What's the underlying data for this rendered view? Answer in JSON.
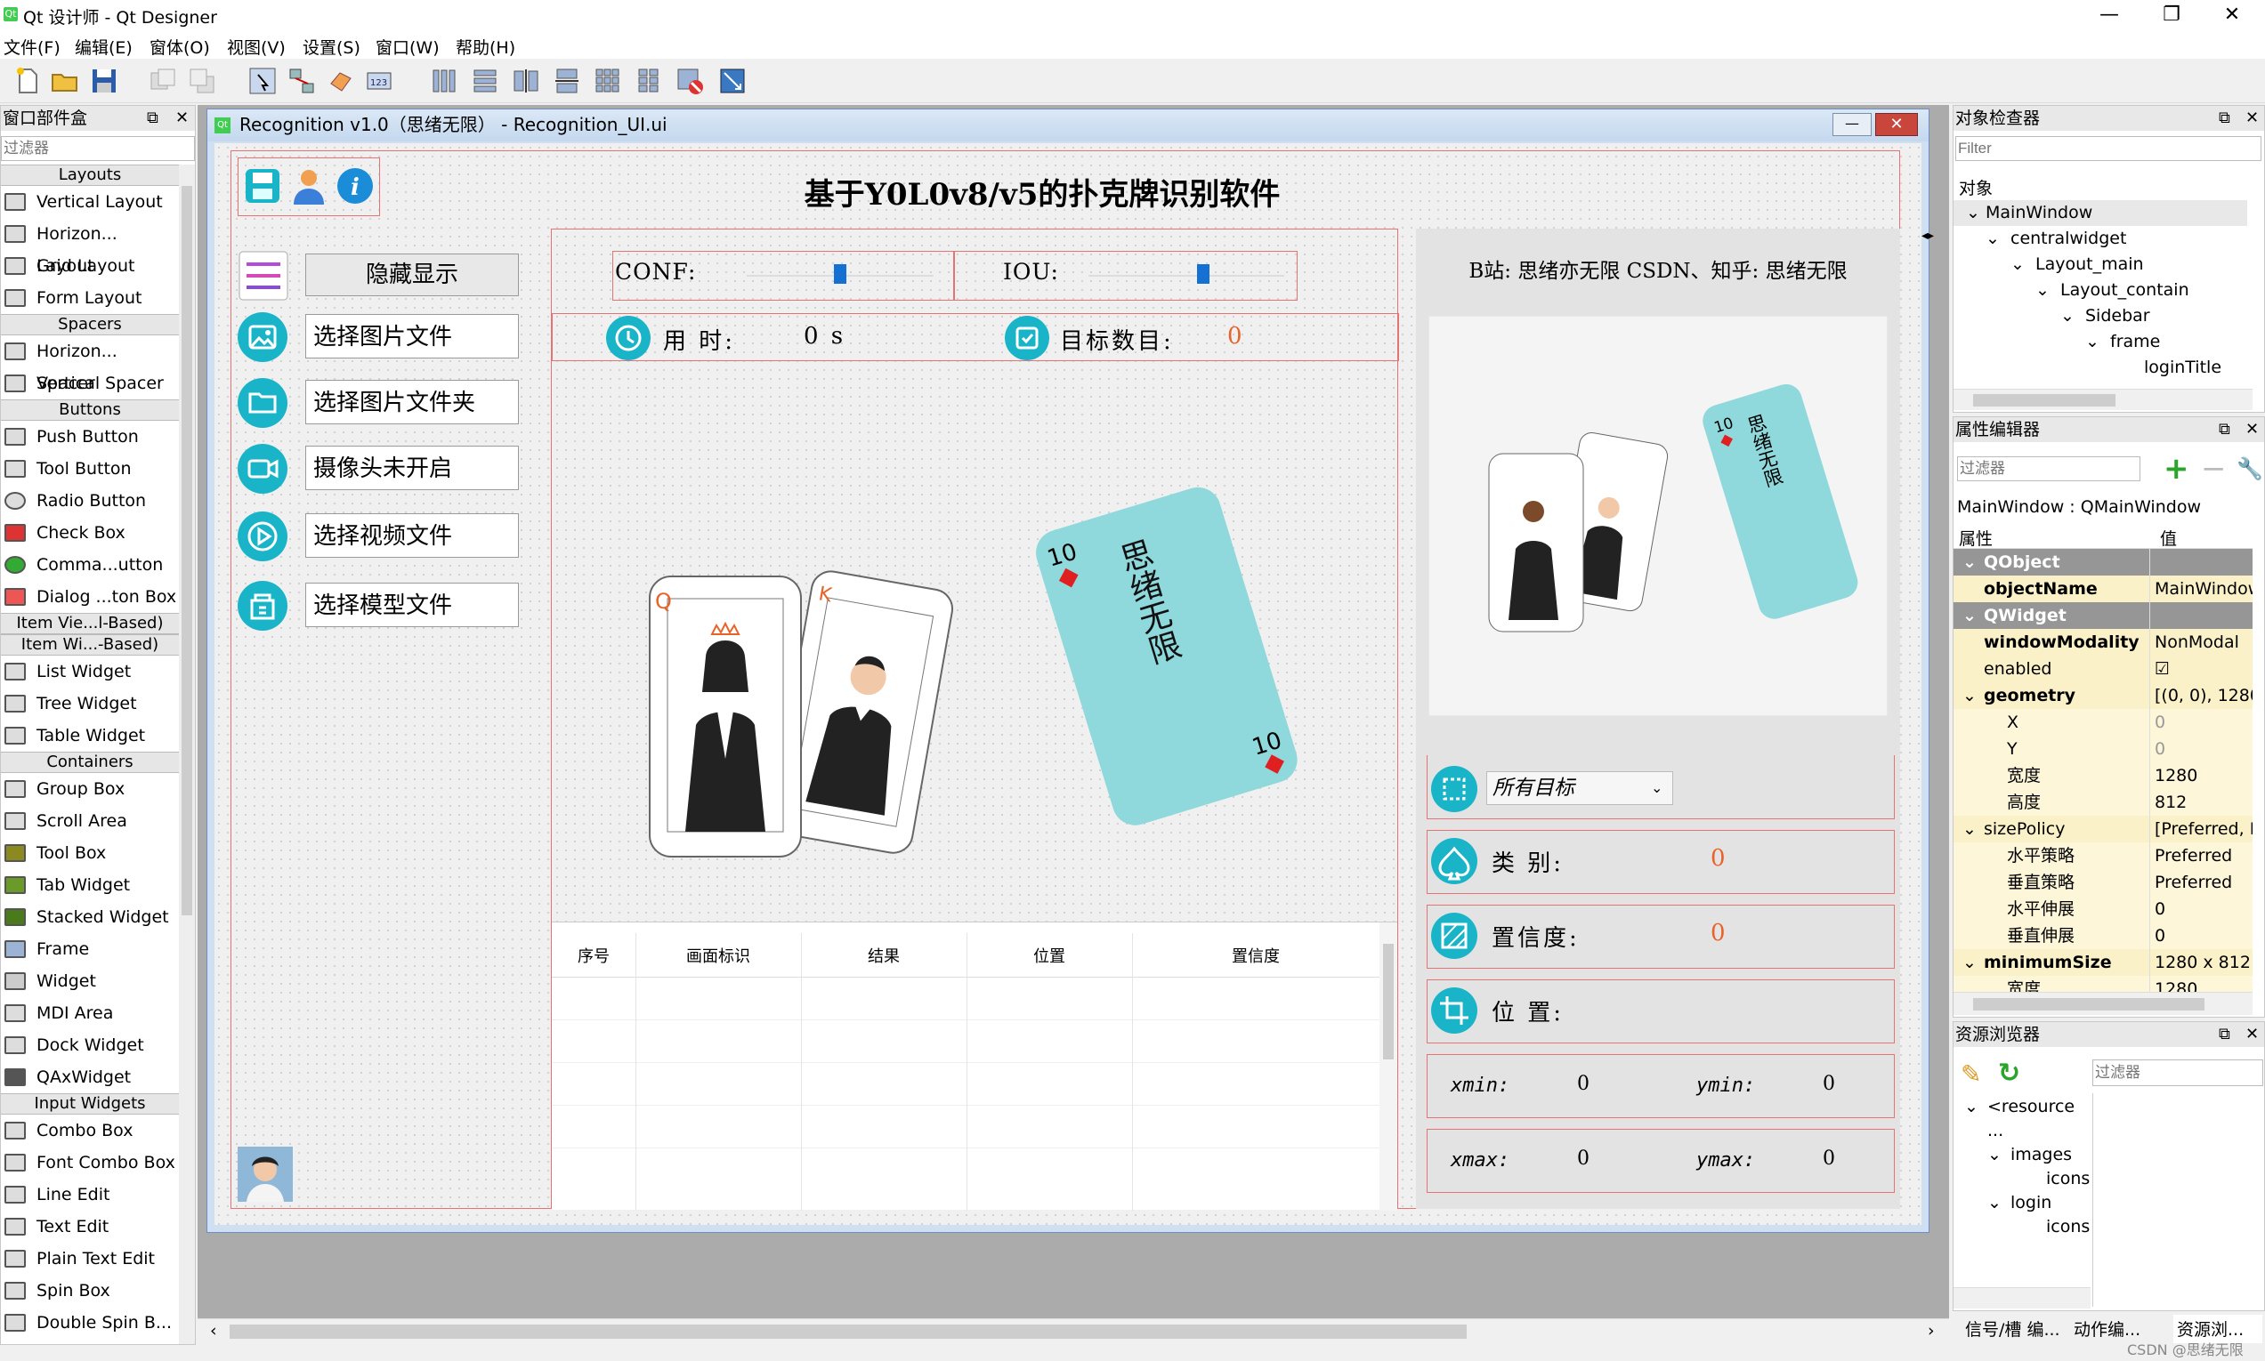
{
  "app": {
    "title": "Qt 设计师 - Qt Designer",
    "logo": "Qt"
  },
  "window_controls": {
    "minimize": "—",
    "restore": "❐",
    "close": "✕"
  },
  "menu": [
    "文件(F)",
    "编辑(E)",
    "窗体(O)",
    "视图(V)",
    "设置(S)",
    "窗口(W)",
    "帮助(H)"
  ],
  "widget_box": {
    "title": "窗口部件盒",
    "filter_placeholder": "过滤器",
    "categories": {
      "layouts": "Layouts",
      "spacers": "Spacers",
      "buttons": "Buttons",
      "item_views": "Item Vie...l-Based)",
      "item_widgets": "Item Wi...-Based)",
      "containers": "Containers",
      "input_widgets": "Input Widgets"
    },
    "layouts": [
      "Vertical Layout",
      "Horizon... Layout",
      "Grid Layout",
      "Form Layout"
    ],
    "spacers": [
      "Horizon... Spacer",
      "Vertical Spacer"
    ],
    "buttons": [
      "Push Button",
      "Tool Button",
      "Radio Button",
      "Check Box",
      "Comma...utton",
      "Dialog ...ton Box"
    ],
    "item_widgets": [
      "List Widget",
      "Tree Widget",
      "Table Widget"
    ],
    "containers": [
      "Group Box",
      "Scroll Area",
      "Tool Box",
      "Tab Widget",
      "Stacked Widget",
      "Frame",
      "Widget",
      "MDI Area",
      "Dock Widget",
      "QAxWidget"
    ],
    "input_widgets": [
      "Combo Box",
      "Font Combo Box",
      "Line Edit",
      "Text Edit",
      "Plain Text Edit",
      "Spin Box",
      "Double Spin B..."
    ]
  },
  "form": {
    "window_title": "Recognition v1.0（思绪无限） - Recognition_UI.ui",
    "heading": "基于Y0L0v8/v5的扑克牌识别软件",
    "toggle_label": "隐藏显示",
    "side_buttons": [
      "选择图片文件",
      "选择图片文件夹",
      "摄像头未开启",
      "选择视频文件",
      "选择模型文件"
    ],
    "conf_label": "CONF:",
    "iou_label": "IOU:",
    "conf_value": 0.5,
    "iou_value": 0.45,
    "time_label": "用 时:",
    "time_value": "0 s",
    "count_label": "目标数目:",
    "count_value": "0",
    "table_headers": [
      "序号",
      "画面标识",
      "结果",
      "位置",
      "置信度"
    ],
    "bili_text": "B站: 思绪亦无限 CSDN、知乎: 思绪无限",
    "card_text": "思绪无限",
    "card_rank": "10",
    "face_card_rank": "Q",
    "king_rank": "K",
    "target_select": "所有目标",
    "class_label": "类 别:",
    "class_value": "0",
    "conf_result_label": "置信度:",
    "conf_result_value": "0",
    "pos_label": "位 置:",
    "xmin_label": "xmin:",
    "xmin_value": "0",
    "ymin_label": "ymin:",
    "ymin_value": "0",
    "xmax_label": "xmax:",
    "xmax_value": "0",
    "ymax_label": "ymax:",
    "ymax_value": "0"
  },
  "object_inspector": {
    "title": "对象检查器",
    "filter_placeholder": "Filter",
    "column": "对象",
    "tree": [
      "MainWindow",
      "centralwidget",
      "Layout_main",
      "Layout_contain",
      "Sidebar",
      "frame",
      "loginTitle"
    ]
  },
  "property_editor": {
    "title": "属性编辑器",
    "filter_placeholder": "过滤器",
    "object_class": "MainWindow : QMainWindow",
    "col_property": "属性",
    "col_value": "值",
    "rows": [
      {
        "kind": "cat",
        "name": "QObject",
        "value": ""
      },
      {
        "kind": "prop",
        "name": "objectName",
        "value": "MainWindow",
        "bold": true
      },
      {
        "kind": "cat",
        "name": "QWidget",
        "value": ""
      },
      {
        "kind": "prop",
        "name": "windowModality",
        "value": "NonModal",
        "bold": true
      },
      {
        "kind": "prop",
        "name": "enabled",
        "value": "☑",
        "bold": false
      },
      {
        "kind": "prop",
        "name": "geometry",
        "value": "[(0, 0), 1280",
        "bold": true,
        "exp": "v"
      },
      {
        "kind": "sub",
        "name": "X",
        "value": "0"
      },
      {
        "kind": "sub",
        "name": "Y",
        "value": "0"
      },
      {
        "kind": "sub",
        "name": "宽度",
        "value": "1280"
      },
      {
        "kind": "sub",
        "name": "高度",
        "value": "812"
      },
      {
        "kind": "prop",
        "name": "sizePolicy",
        "value": "[Preferred, P",
        "bold": false,
        "exp": "v"
      },
      {
        "kind": "sub",
        "name": "水平策略",
        "value": "Preferred"
      },
      {
        "kind": "sub",
        "name": "垂直策略",
        "value": "Preferred"
      },
      {
        "kind": "sub",
        "name": "水平伸展",
        "value": "0"
      },
      {
        "kind": "sub",
        "name": "垂直伸展",
        "value": "0"
      },
      {
        "kind": "prop",
        "name": "minimumSize",
        "value": "1280 x 812",
        "bold": true,
        "exp": "v"
      },
      {
        "kind": "sub",
        "name": "宽度",
        "value": "1280"
      }
    ]
  },
  "resource_browser": {
    "title": "资源浏览器",
    "filter_placeholder": "过滤器",
    "tree": [
      "<resource ...",
      "images",
      "icons",
      "login",
      "icons"
    ]
  },
  "bottom_tabs": [
    "信号/槽 编...",
    "动作编...",
    "资源浏..."
  ],
  "watermark": "CSDN @思绪无限",
  "colors": {
    "accent": "#19b4c8",
    "card": "#8fd8dc",
    "red_border": "#e57373",
    "orange_value": "#e8632a"
  }
}
